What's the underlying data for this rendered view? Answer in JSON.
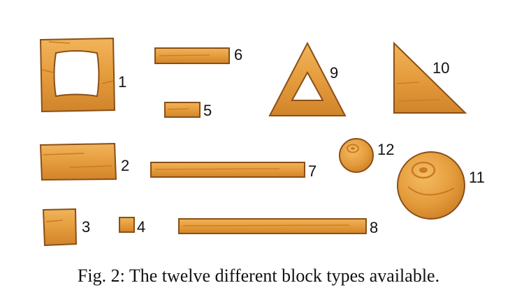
{
  "figure": {
    "caption": "Fig. 2: The twelve different block types available.",
    "colors": {
      "wood_fill": "#E39A3A",
      "wood_light": "#F2B45A",
      "wood_dark": "#C97A23",
      "outline": "#8A4F17"
    },
    "blocks": [
      {
        "label": "1",
        "shape": "square-frame"
      },
      {
        "label": "2",
        "shape": "large-rectangle"
      },
      {
        "label": "3",
        "shape": "small-square"
      },
      {
        "label": "4",
        "shape": "tiny-square"
      },
      {
        "label": "5",
        "shape": "short-bar"
      },
      {
        "label": "6",
        "shape": "medium-bar"
      },
      {
        "label": "7",
        "shape": "long-bar"
      },
      {
        "label": "8",
        "shape": "long-bar"
      },
      {
        "label": "9",
        "shape": "triangle-frame"
      },
      {
        "label": "10",
        "shape": "right-triangle"
      },
      {
        "label": "11",
        "shape": "large-circle"
      },
      {
        "label": "12",
        "shape": "small-circle"
      }
    ]
  }
}
